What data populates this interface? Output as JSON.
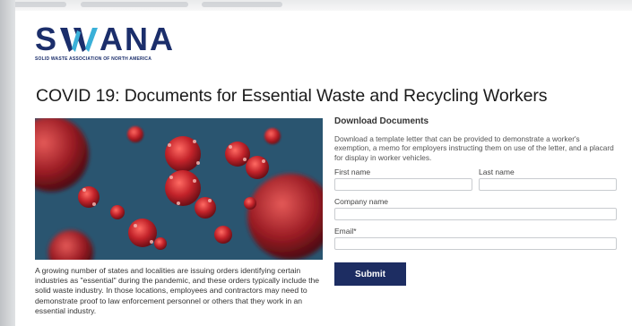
{
  "header": {
    "logo_text_left": "S",
    "logo_text_right": "ANA",
    "logo_tagline": "SOLID WASTE ASSOCIATION OF NORTH AMERICA",
    "brand_color": "#1b2e6b"
  },
  "page": {
    "title": "COVID 19: Documents for Essential Waste and Recycling Workers",
    "hero_image": "coronavirus-illustration",
    "body_text": "A growing number of states and localities are issuing orders identifying certain industries as \"essential\" during the pandemic, and these orders typically include the solid waste industry. In those locations, employees and contractors may need to demonstrate proof to law enforcement personnel or others that they work in an essential industry."
  },
  "form": {
    "title": "Download Documents",
    "description": "Download a template letter that can be provided to demonstrate a worker's exemption, a memo for employers instructing them on use of the letter, and a placard for display in worker vehicles.",
    "first_name_label": "First name",
    "first_name_value": "",
    "last_name_label": "Last name",
    "last_name_value": "",
    "company_label": "Company name",
    "company_value": "",
    "email_label": "Email*",
    "email_value": "",
    "submit_label": "Submit",
    "button_color": "#1d2d62"
  }
}
